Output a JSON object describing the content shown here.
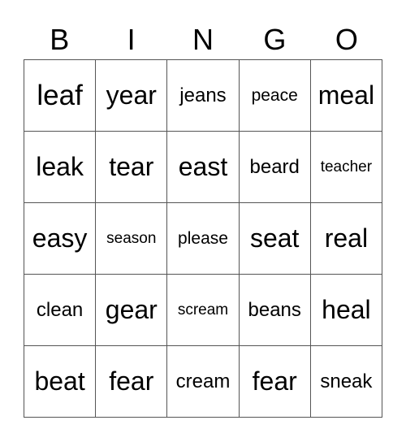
{
  "header": [
    "B",
    "I",
    "N",
    "G",
    "O"
  ],
  "cells": [
    [
      "leaf",
      "year",
      "jeans",
      "peace",
      "meal"
    ],
    [
      "leak",
      "tear",
      "east",
      "beard",
      "teacher"
    ],
    [
      "easy",
      "season",
      "please",
      "seat",
      "real"
    ],
    [
      "clean",
      "gear",
      "scream",
      "beans",
      "heal"
    ],
    [
      "beat",
      "fear",
      "cream",
      "fear",
      "sneak"
    ]
  ]
}
